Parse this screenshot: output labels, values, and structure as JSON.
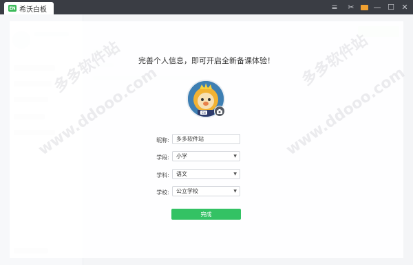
{
  "app": {
    "title": "希沃白板",
    "logo_text": "EN"
  },
  "window_controls": {
    "menu": "≡",
    "clothes": "✂",
    "mail": "mail",
    "minimize": "—",
    "maximize": "☐",
    "close": "✕"
  },
  "dialog": {
    "heading": "完善个人信息，即可开启全新备课体验！",
    "avatar_badge": "EN",
    "fields": [
      {
        "label": "昵称:",
        "value": "多多软件站",
        "type": "text"
      },
      {
        "label": "学段:",
        "value": "小学",
        "type": "select"
      },
      {
        "label": "学科:",
        "value": "语文",
        "type": "select"
      },
      {
        "label": "学校:",
        "value": "公立学校",
        "type": "select"
      }
    ],
    "submit_label": "完成"
  },
  "watermarks": [
    "www.ddooo.com",
    "多多软件站",
    "www.ddooo.com",
    "多多软件站"
  ],
  "colors": {
    "titlebar": "#3a3d44",
    "accent_green": "#33c264",
    "avatar_bg": "#3e7fb3"
  }
}
